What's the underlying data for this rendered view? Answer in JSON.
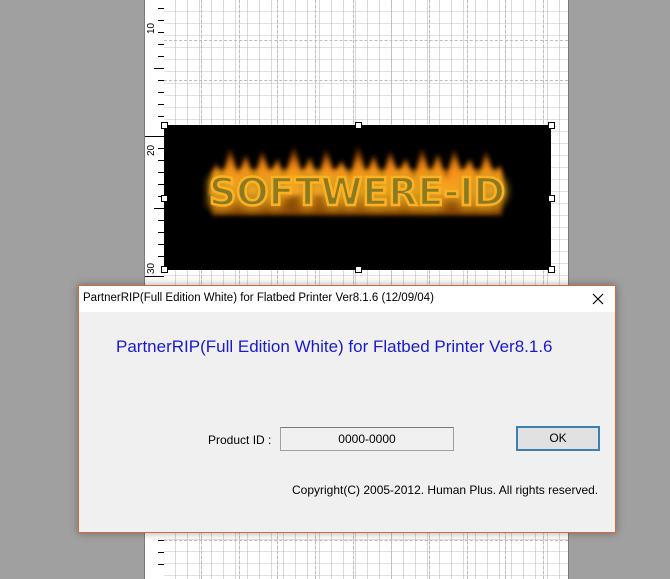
{
  "ruler": {
    "labels": [
      "10",
      "20",
      "30"
    ]
  },
  "artwork": {
    "text": "SOFTWERE-ID"
  },
  "dialog": {
    "title": "PartnerRIP(Full Edition White) for Flatbed Printer Ver8.1.6 (12/09/04)",
    "product_name": "PartnerRIP(Full Edition White) for Flatbed Printer Ver8.1.6",
    "product_id_label": "Product ID :",
    "product_id_value": "0000-0000",
    "ok_label": "OK",
    "copyright": "Copyright(C) 2005-2012. Human Plus. All rights reserved."
  },
  "colors": {
    "product_name": "#1a1acc",
    "dialog_border": "#d46a3a",
    "ok_border": "#3c7fb1"
  },
  "icons": {
    "close": "close-icon"
  }
}
